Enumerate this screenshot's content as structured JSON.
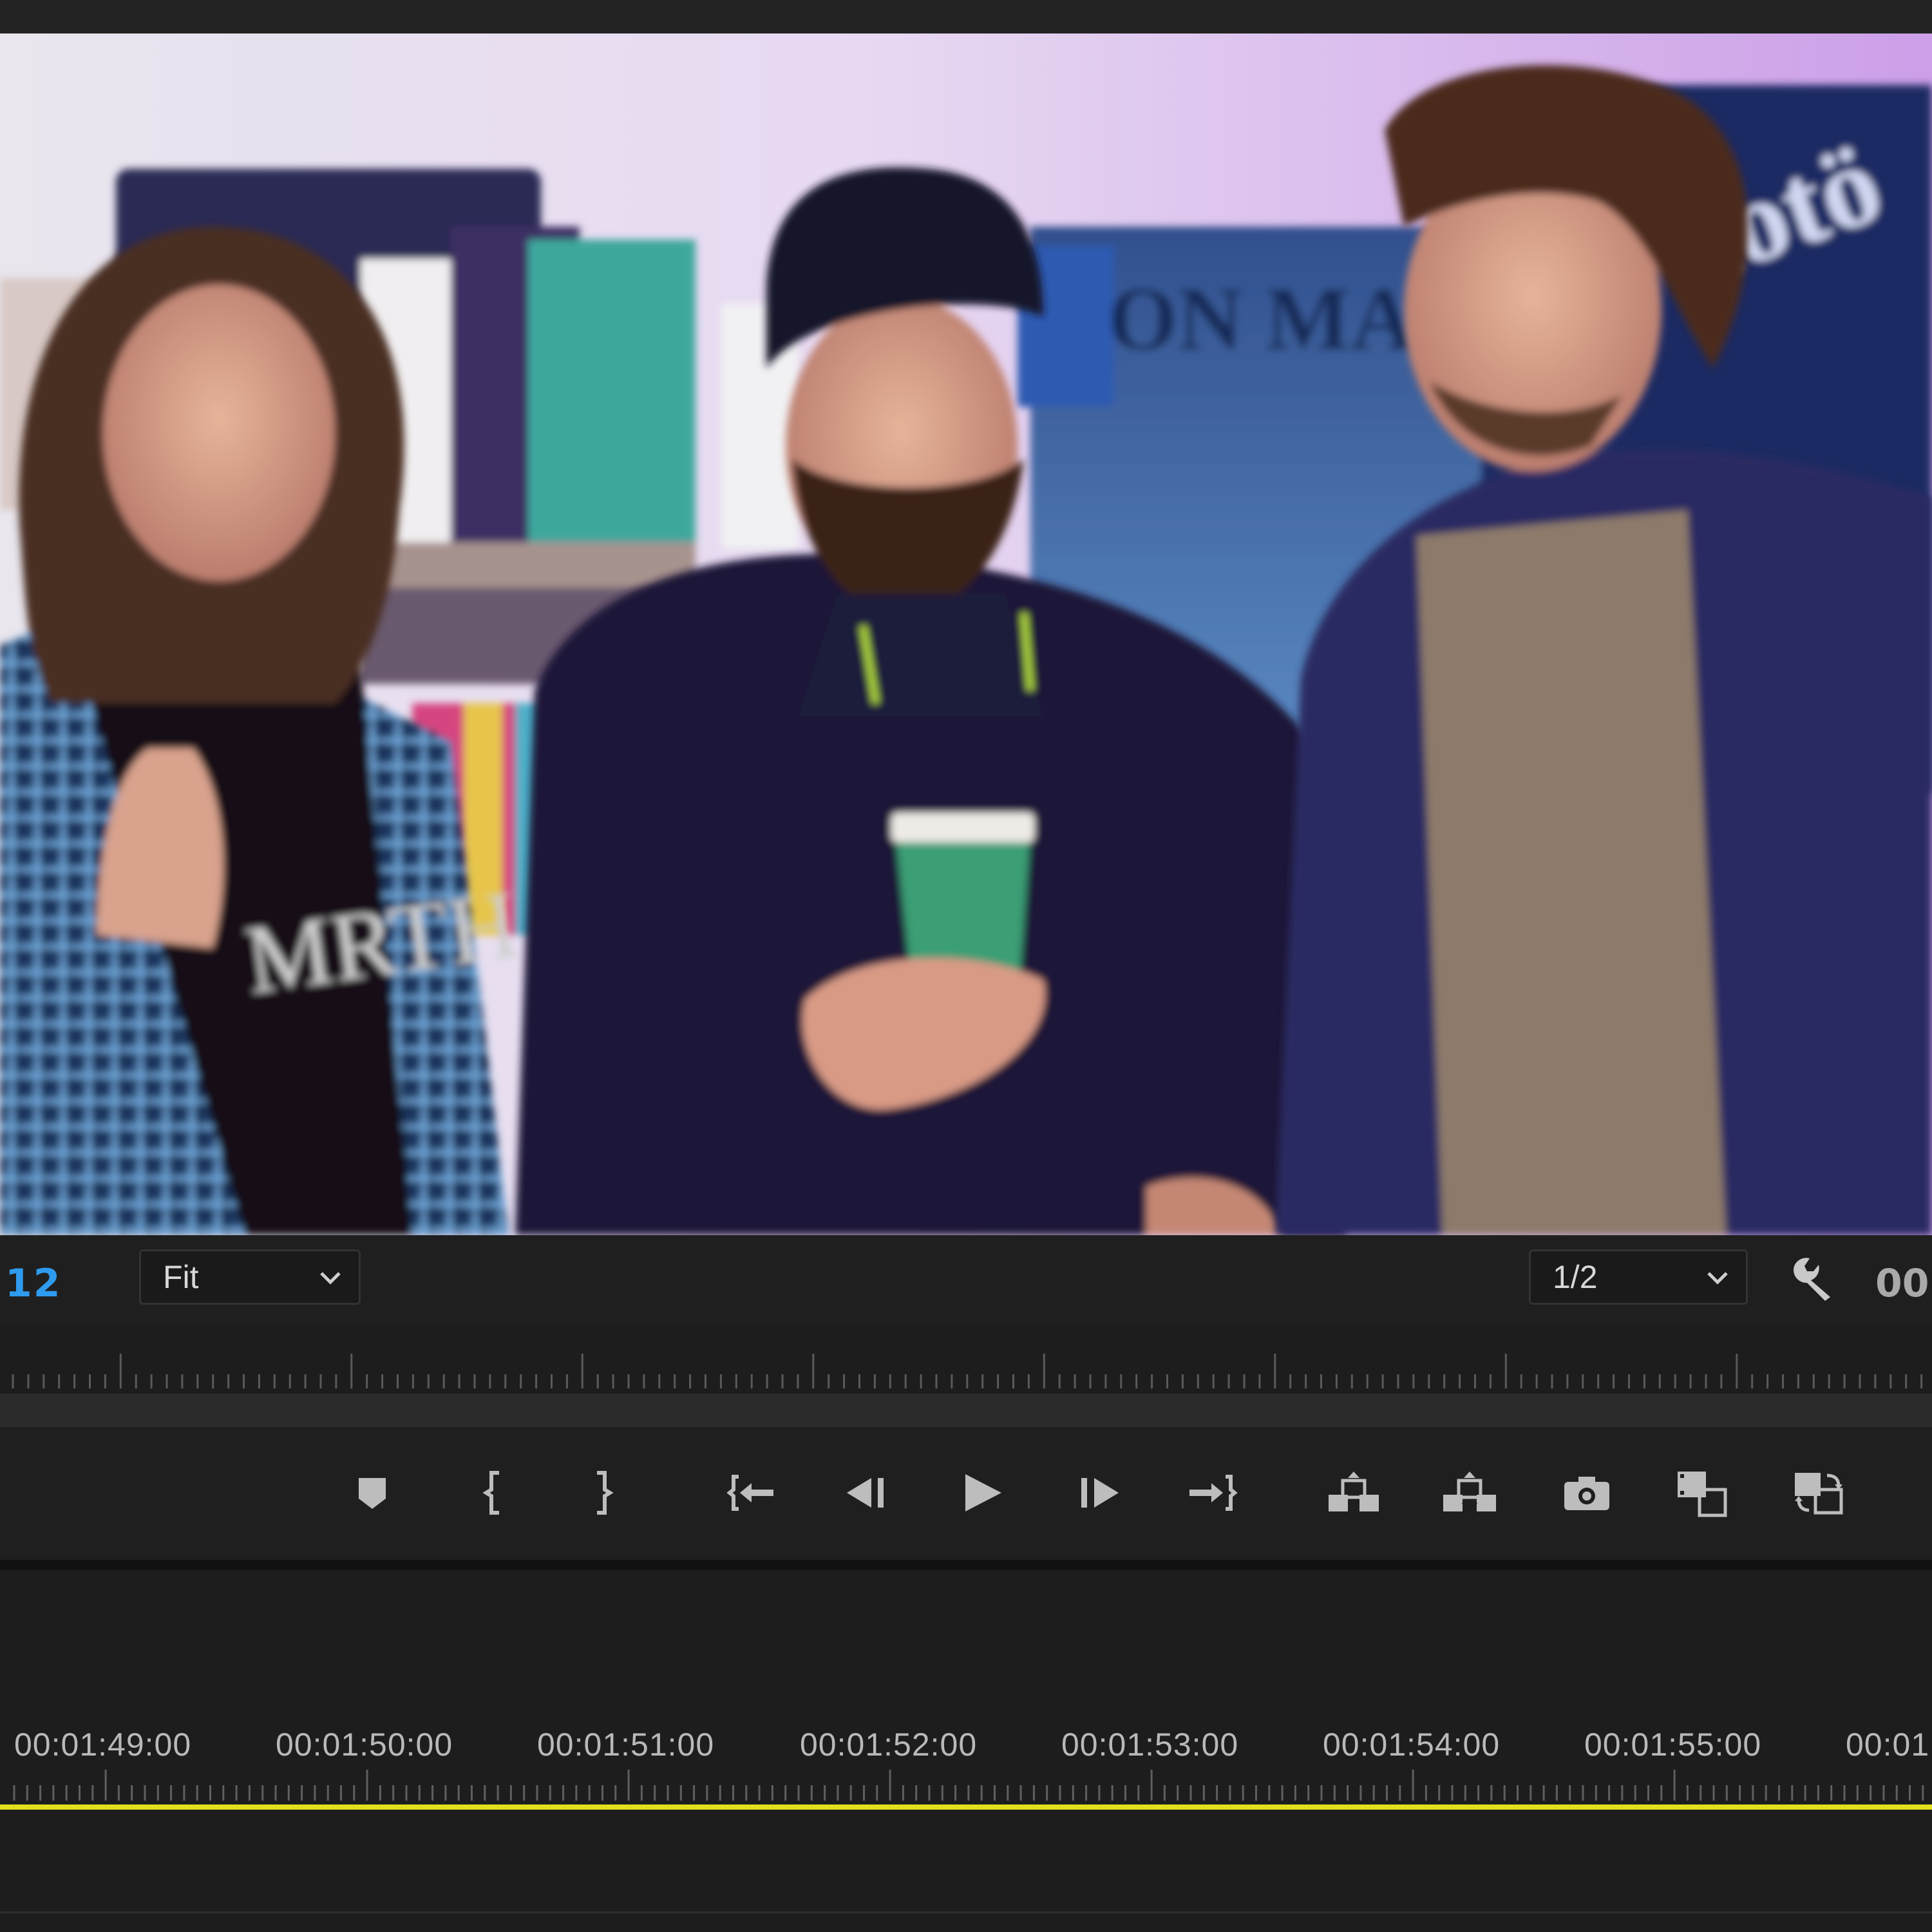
{
  "monitor": {
    "timecode_current": "12",
    "timecode_end": "00",
    "zoom": {
      "selected": "Fit"
    },
    "resolution": {
      "selected": "1/2"
    }
  },
  "transport_buttons": [
    {
      "name": "add-marker-button",
      "icon": "marker-icon"
    },
    {
      "name": "mark-in-button",
      "icon": "mark-in-icon"
    },
    {
      "name": "mark-out-button",
      "icon": "mark-out-icon"
    },
    {
      "name": "go-to-in-button",
      "icon": "go-to-in-icon"
    },
    {
      "name": "step-back-button",
      "icon": "step-back-icon"
    },
    {
      "name": "play-button",
      "icon": "play-icon"
    },
    {
      "name": "step-forward-button",
      "icon": "step-forward-icon"
    },
    {
      "name": "go-to-out-button",
      "icon": "go-to-out-icon"
    },
    {
      "name": "lift-button",
      "icon": "lift-icon"
    },
    {
      "name": "extract-button",
      "icon": "extract-icon"
    },
    {
      "name": "export-frame-button",
      "icon": "camera-icon"
    },
    {
      "name": "comparison-view-button",
      "icon": "comparison-view-icon"
    },
    {
      "name": "toggle-proxies-button",
      "icon": "proxy-toggle-icon"
    }
  ],
  "timeline": {
    "timecodes": [
      "00:01:49:00",
      "00:01:50:00",
      "00:01:51:00",
      "00:01:52:00",
      "00:01:53:00",
      "00:01:54:00",
      "00:01:55:00",
      "00:01"
    ]
  },
  "colors": {
    "timecode_accent": "#2f9bef",
    "playhead_bar": "#e3e01f",
    "panel_bg": "#1f1f1f"
  }
}
